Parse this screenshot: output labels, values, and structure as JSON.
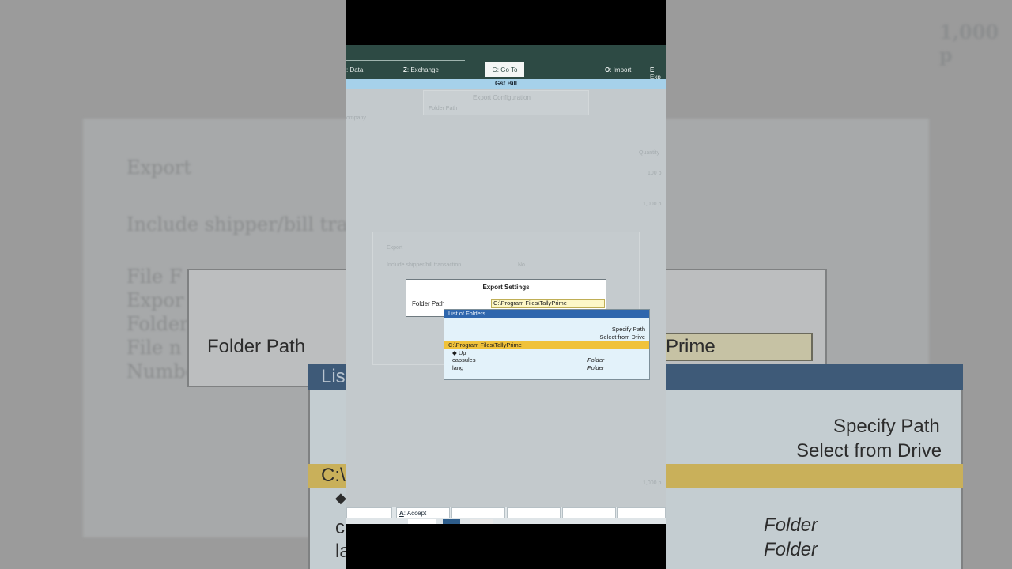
{
  "toolbar": {
    "data": ": Data",
    "exchange_key": "Z",
    "exchange": ": Exchange",
    "goto_key": "G",
    "goto": ": Go To",
    "import_key": "O",
    "import": ": Import",
    "export_key": "E",
    "export": ": Exp"
  },
  "window_title": "Gst Bill",
  "background": {
    "export_config": "Export Configuration",
    "folder_path_ghost": "Folder Path",
    "company": "ompany",
    "quantity": "Quantity",
    "qty1": "100 p",
    "qty2": "1,000 p",
    "qty3": "1,000 p",
    "export_heading": "Export",
    "include_label": "Include shipper/bill transaction",
    "include_value": "No",
    "zoom_heading": "Export",
    "zoom_include": "Include shipper/bill transaction",
    "zoom_top_right": "1,000 p",
    "zoom_lines": [
      "File F",
      "Expor",
      "Folder",
      "File n",
      "Numbe"
    ],
    "zoom_folder_path": "Folder Path",
    "zoom_prime": "Prime",
    "zoom_list": "Lis",
    "zoom_specify": "Specify Path",
    "zoom_select": "Select from Drive",
    "zoom_sel": "C:\\",
    "zoom_c": "c",
    "zoom_la": "la",
    "zoom_folder1": "Folder",
    "zoom_folder2": "Folder"
  },
  "dialog": {
    "title": "Export Settings",
    "folder_path_label": "Folder Path",
    "folder_path_value": "C:\\Program Files\\TallyPrime"
  },
  "folder_list": {
    "title": "List of Folders",
    "specify_path": "Specify Path",
    "select_from_drive": "Select from Drive",
    "selected": "C:\\Program Files\\TallyPrime",
    "up": "Up",
    "rows": [
      {
        "name": "capsules",
        "type": "Folder"
      },
      {
        "name": "lang",
        "type": "Folder"
      }
    ]
  },
  "bottom": {
    "accept_key": "A",
    "accept": ": Accept"
  }
}
